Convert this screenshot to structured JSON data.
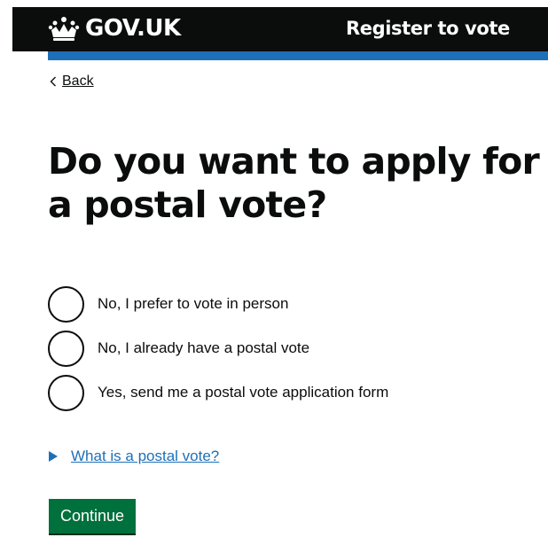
{
  "header": {
    "logo_text": "GOV.UK",
    "logo_icon": "crown-icon",
    "service_name": "Register to vote"
  },
  "back_link": {
    "label": "Back",
    "icon": "chevron-left-icon"
  },
  "question": {
    "title": "Do you want to apply for a postal vote?"
  },
  "options": [
    {
      "label": "No, I prefer to vote in person",
      "selected": false
    },
    {
      "label": "No, I already have a postal vote",
      "selected": false
    },
    {
      "label": "Yes, send me a postal vote application form",
      "selected": false
    }
  ],
  "details": {
    "summary": "What is a postal vote?",
    "icon": "triangle-right-icon"
  },
  "continue_button": {
    "label": "Continue"
  },
  "colors": {
    "header_bg": "#0b0c0c",
    "header_stripe": "#1d70b8",
    "link": "#1d70b8",
    "button": "#00703c",
    "text": "#0b0c0c"
  }
}
